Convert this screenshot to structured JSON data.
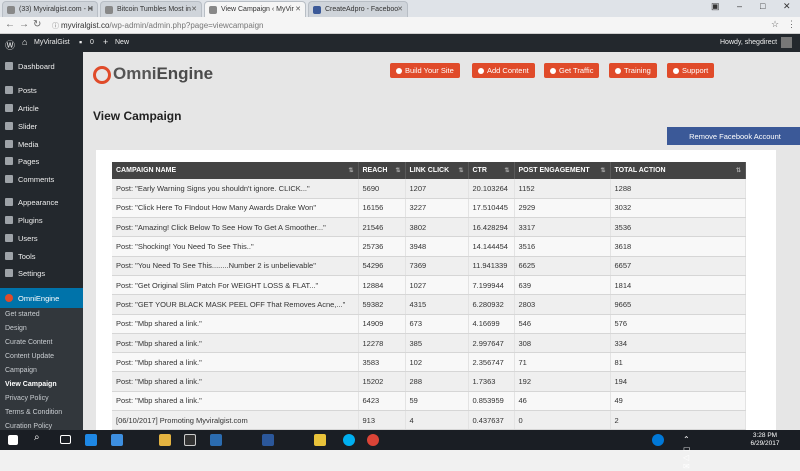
{
  "browser": {
    "tabs": [
      {
        "label": "(33) Myviralgist.com - H"
      },
      {
        "label": "Bitcoin Tumbles Most in"
      },
      {
        "label": "View Campaign ‹ MyVir"
      },
      {
        "label": "CreateAdpro - Faceboo"
      }
    ],
    "url_host": "myviralgist.co",
    "url_path": "/wp-admin/admin.php?page=viewcampaign"
  },
  "adminbar": {
    "site_name": "MyViralGist",
    "comments_count": "0",
    "new_label": "New",
    "greeting": "Howdy, shegdirect"
  },
  "sidebar": {
    "items": [
      {
        "label": "Dashboard"
      },
      {
        "label": "Posts"
      },
      {
        "label": "Article"
      },
      {
        "label": "Slider"
      },
      {
        "label": "Media"
      },
      {
        "label": "Pages"
      },
      {
        "label": "Comments"
      },
      {
        "label": "Appearance"
      },
      {
        "label": "Plugins"
      },
      {
        "label": "Users"
      },
      {
        "label": "Tools"
      },
      {
        "label": "Settings"
      },
      {
        "label": "OmniEngine"
      }
    ],
    "subitems": [
      {
        "label": "Get started"
      },
      {
        "label": "Design"
      },
      {
        "label": "Curate Content"
      },
      {
        "label": "Content Update"
      },
      {
        "label": "Campaign"
      },
      {
        "label": "View Campaign"
      },
      {
        "label": "Privacy Policy"
      },
      {
        "label": "Terms & Condition"
      },
      {
        "label": "Curation Policy"
      }
    ]
  },
  "brand": {
    "logo_omni": "Omni",
    "logo_engine": "Engine",
    "accent": "#e04b2a"
  },
  "toolbar": {
    "build": "Build Your Site",
    "add": "Add Content",
    "traffic": "Get Traffic",
    "training": "Training",
    "support": "Support"
  },
  "page": {
    "title": "View Campaign",
    "remove_fb": "Remove Facebook Account"
  },
  "table": {
    "headers": [
      "CAMPAIGN NAME",
      "REACH",
      "LINK CLICK",
      "CTR",
      "POST ENGAGEMENT",
      "TOTAL ACTION"
    ],
    "rows": [
      [
        "Post: \"Early Warning Signs you shouldn't ignore. CLICK...\"",
        "5690",
        "1207",
        "20.103264",
        "1152",
        "1288"
      ],
      [
        "Post: \"Click Here To FIndout How Many Awards Drake Won\"",
        "16156",
        "3227",
        "17.510445",
        "2929",
        "3032"
      ],
      [
        "Post: \"Amazing! Click Below To See How To Get A Smoother...\"",
        "21546",
        "3802",
        "16.428294",
        "3317",
        "3536"
      ],
      [
        "Post: \"Shocking! You Need To See This..\"",
        "25736",
        "3948",
        "14.144454",
        "3516",
        "3618"
      ],
      [
        "Post: \"You Need To See This........Number 2 is unbelievable\"",
        "54296",
        "7369",
        "11.941339",
        "6625",
        "6657"
      ],
      [
        "Post: \"Get Original Slim Patch For WEIGHT LOSS & FLAT...\"",
        "12884",
        "1027",
        "7.199944",
        "639",
        "1814"
      ],
      [
        "Post: \"GET YOUR BLACK MASK PEEL OFF That Removes Acne,...\"",
        "59382",
        "4315",
        "6.280932",
        "2803",
        "9665"
      ],
      [
        "Post: \"Mbp shared a link.\"",
        "14909",
        "673",
        "4.16699",
        "546",
        "576"
      ],
      [
        "Post: \"Mbp shared a link.\"",
        "12278",
        "385",
        "2.997647",
        "308",
        "334"
      ],
      [
        "Post: \"Mbp shared a link.\"",
        "3583",
        "102",
        "2.356747",
        "71",
        "81"
      ],
      [
        "Post: \"Mbp shared a link.\"",
        "15202",
        "288",
        "1.7363",
        "192",
        "194"
      ],
      [
        "Post: \"Mbp shared a link.\"",
        "6423",
        "59",
        "0.853959",
        "46",
        "49"
      ],
      [
        "[06/10/2017] Promoting Myviralgist.com",
        "913",
        "4",
        "0.437637",
        "0",
        "2"
      ]
    ]
  },
  "taskbar": {
    "time": "3:28 PM",
    "date": "6/29/2017"
  }
}
